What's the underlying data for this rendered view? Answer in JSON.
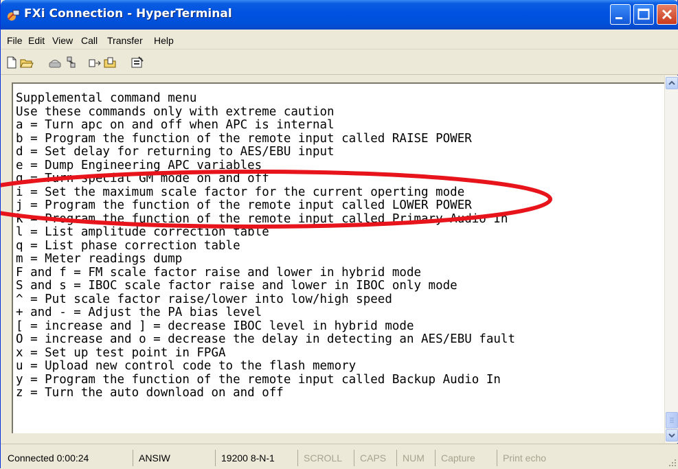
{
  "window": {
    "title": "FXi Connection - HyperTerminal",
    "controls": {
      "minimize": "minimize-button",
      "maximize": "maximize-button",
      "close": "close-button"
    }
  },
  "menu": [
    "File",
    "Edit",
    "View",
    "Call",
    "Transfer",
    "Help"
  ],
  "toolbar": [
    "new-connection-icon",
    "open-icon",
    "call-icon",
    "disconnect-icon",
    "send-icon",
    "receive-icon",
    "properties-icon"
  ],
  "terminal": {
    "lines": [
      "Supplemental command menu",
      "Use these commands only with extreme caution",
      "a = Turn apc on and off when APC is internal",
      "b = Program the function of the remote input called RAISE POWER",
      "d = Set delay for returning to AES/EBU input",
      "e = Dump Engineering APC variables",
      "g = Turn special GM mode on and off",
      "i = Set the maximum scale factor for the current operting mode",
      "j = Program the function of the remote input called LOWER POWER",
      "k = Program the function of the remote input called Primary Audio In",
      "l = List amplitude correction table",
      "q = List phase correction table",
      "m = Meter readings dump",
      "F and f = FM scale factor raise and lower in hybrid mode",
      "S and s = IBOC scale factor raise and lower in IBOC only mode",
      "^ = Put scale factor raise/lower into low/high speed",
      "+ and - = Adjust the PA bias level",
      "[ = increase and ] = decrease IBOC level in hybrid mode",
      "O = increase and o = decrease the delay in detecting an AES/EBU fault",
      "x = Set up test point in FPGA",
      "u = Upload new control code to the flash memory",
      "y = Program the function of the remote input called Backup Audio In",
      "z = Turn the auto download on and off"
    ],
    "highlight_color": "#e8141c"
  },
  "status": {
    "connected": "Connected 0:00:24",
    "emulation": "ANSIW",
    "settings": "19200 8-N-1",
    "scroll": "SCROLL",
    "caps": "CAPS",
    "num": "NUM",
    "capture": "Capture",
    "print_echo": "Print echo"
  },
  "colors": {
    "titlebar": "#0053e1",
    "chrome": "#ece9d8",
    "terminal_bg": "#ffffff"
  }
}
